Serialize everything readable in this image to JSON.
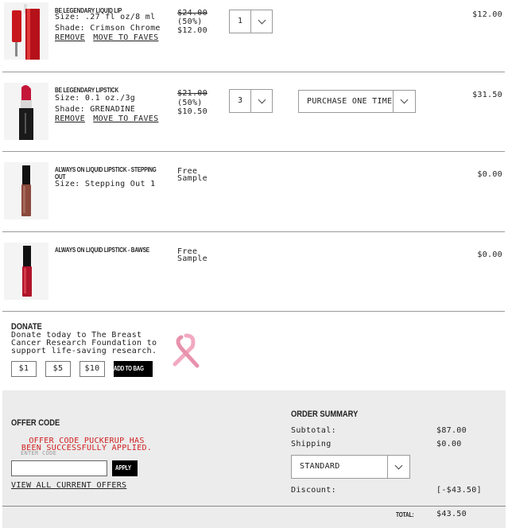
{
  "items": [
    {
      "name": "BE LEGENDARY LIQUID LIP",
      "size": "Size: .27 fl oz/8 ml",
      "shade": "Shade: Crimson Chrome",
      "remove": "REMOVE",
      "move": "MOVE TO FAVES",
      "original_price": "$24.00",
      "discount": "(50%)",
      "sale_price": "$12.00",
      "quantity": "1",
      "total": "$12.00",
      "product_color": "#c8171c"
    },
    {
      "name": "BE LEGENDARY LIPSTICK",
      "size": "Size: 0.1 oz./3g",
      "shade": "Shade: GRENADINE",
      "remove": "REMOVE",
      "move": "MOVE TO FAVES",
      "original_price": "$21.00",
      "discount": "(50%)",
      "sale_price": "$10.50",
      "quantity": "3",
      "purchase_option": "PURCHASE ONE TIME",
      "total": "$31.50",
      "product_color": "#c41638"
    },
    {
      "name_line1": "ALWAYS ON LIQUID LIPSTICK - STEPPING",
      "name_line2": "OUT",
      "size": "Size: Stepping Out 1",
      "price_line1": "Free",
      "price_line2": "Sample",
      "total": "$0.00",
      "product_color": "#8a4a3c"
    },
    {
      "name": "ALWAYS ON LIQUID LIPSTICK - BAWSE",
      "price_line1": "Free",
      "price_line2": "Sample",
      "total": "$0.00",
      "product_color": "#b0142a"
    }
  ],
  "donate": {
    "title": "DONATE",
    "line1": "Donate today to The Breast",
    "line2": "Cancer Research Foundation to",
    "line3": "support life-saving research.",
    "amounts": [
      "$1",
      "$5",
      "$10"
    ],
    "add_label": "ADD TO BAG",
    "ribbon_color": "#f2a9c0"
  },
  "offer": {
    "title": "OFFER CODE",
    "message_line1": "OFFER CODE PUCKERUP HAS",
    "message_line2": "BEEN SUCCESSFULLY APPLIED.",
    "placeholder": "ENTER CODE",
    "apply_label": "APPLY",
    "view_offers": "VIEW ALL CURRENT OFFERS",
    "message_color": "#d02020"
  },
  "summary": {
    "title": "ORDER SUMMARY",
    "subtotal_label": "Subtotal:",
    "subtotal": "$87.00",
    "shipping_label": "Shipping",
    "shipping": "$0.00",
    "shipping_method": "STANDARD",
    "discount_label": "Discount:",
    "discount": "[-$43.50]",
    "total_label": "TOTAL:",
    "total": "$43.50"
  }
}
